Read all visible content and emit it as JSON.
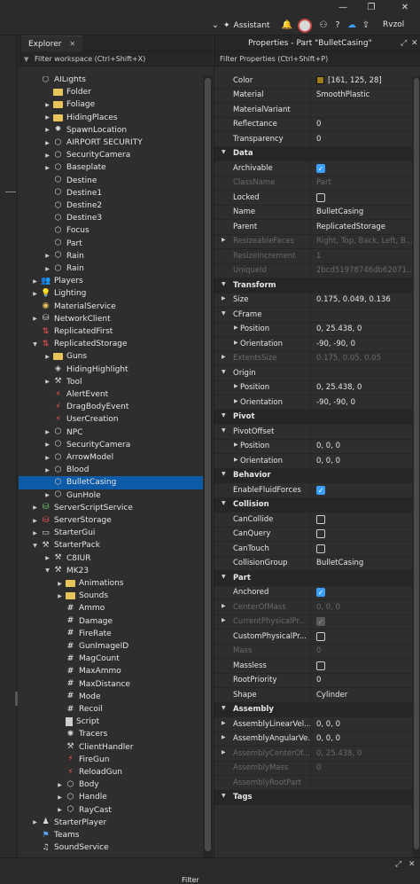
{
  "window": {
    "minimize": "—",
    "maximize": "❐",
    "close": "✕"
  },
  "topbar": {
    "assistant_label": "Assistant",
    "username": "Rvzol"
  },
  "explorer": {
    "tab_label": "Explorer",
    "filter_placeholder": "Filter workspace (Ctrl+Shift+X)",
    "items": [
      {
        "label": "AILights",
        "indent": 0,
        "arrow": "",
        "icon": "part-icon",
        "glyph": "⬡",
        "cls": "part"
      },
      {
        "label": "Folder",
        "indent": 1,
        "arrow": "",
        "icon": "folder-icon",
        "glyph": "",
        "cls": "folder"
      },
      {
        "label": "Foliage",
        "indent": 1,
        "arrow": "▶",
        "icon": "folder-icon",
        "glyph": "",
        "cls": "folder"
      },
      {
        "label": "HidingPlaces",
        "indent": 1,
        "arrow": "▶",
        "icon": "folder-icon",
        "glyph": "",
        "cls": "folder"
      },
      {
        "label": "SpawnLocation",
        "indent": 1,
        "arrow": "▶",
        "icon": "spawn-location-icon",
        "glyph": "✹",
        "cls": ""
      },
      {
        "label": "AIRPORT SECURITY",
        "indent": 1,
        "arrow": "▶",
        "icon": "model-icon",
        "glyph": "⬡",
        "cls": "part"
      },
      {
        "label": "SecurityCamera",
        "indent": 1,
        "arrow": "▶",
        "icon": "model-icon",
        "glyph": "⬡",
        "cls": "part"
      },
      {
        "label": "Baseplate",
        "indent": 1,
        "arrow": "▶",
        "icon": "part-icon",
        "glyph": "⬡",
        "cls": "part"
      },
      {
        "label": "Destine",
        "indent": 1,
        "arrow": "",
        "icon": "part-icon",
        "glyph": "⬡",
        "cls": "part"
      },
      {
        "label": "Destine1",
        "indent": 1,
        "arrow": "",
        "icon": "part-icon",
        "glyph": "⬡",
        "cls": "part"
      },
      {
        "label": "Destine2",
        "indent": 1,
        "arrow": "",
        "icon": "part-icon",
        "glyph": "⬡",
        "cls": "part"
      },
      {
        "label": "Destine3",
        "indent": 1,
        "arrow": "",
        "icon": "part-icon",
        "glyph": "⬡",
        "cls": "part"
      },
      {
        "label": "Focus",
        "indent": 1,
        "arrow": "",
        "icon": "part-icon",
        "glyph": "⬡",
        "cls": "part"
      },
      {
        "label": "Part",
        "indent": 1,
        "arrow": "",
        "icon": "part-icon",
        "glyph": "⬡",
        "cls": "part"
      },
      {
        "label": "Rain",
        "indent": 1,
        "arrow": "▶",
        "icon": "part-icon",
        "glyph": "⬡",
        "cls": "part"
      },
      {
        "label": "Rain",
        "indent": 1,
        "arrow": "▶",
        "icon": "part-icon",
        "glyph": "⬡",
        "cls": "part"
      },
      {
        "label": "Players",
        "indent": 0,
        "arrow": "▶",
        "icon": "players-icon",
        "glyph": "👥",
        "cls": "blue"
      },
      {
        "label": "Lighting",
        "indent": 0,
        "arrow": "▶",
        "icon": "lighting-icon",
        "glyph": "💡",
        "cls": "yellow"
      },
      {
        "label": "MaterialService",
        "indent": 0,
        "arrow": "",
        "icon": "material-service-icon",
        "glyph": "◉",
        "cls": "yellow"
      },
      {
        "label": "NetworkClient",
        "indent": 0,
        "arrow": "▶",
        "icon": "network-client-icon",
        "glyph": "⛁",
        "cls": ""
      },
      {
        "label": "ReplicatedFirst",
        "indent": 0,
        "arrow": "",
        "icon": "replicated-first-icon",
        "glyph": "⇅",
        "cls": "red"
      },
      {
        "label": "ReplicatedStorage",
        "indent": 0,
        "arrow": "▼",
        "icon": "replicated-storage-icon",
        "glyph": "⇅",
        "cls": "red"
      },
      {
        "label": "Guns",
        "indent": 1,
        "arrow": "▶",
        "icon": "folder-icon",
        "glyph": "",
        "cls": "folder"
      },
      {
        "label": "HidingHighlight",
        "indent": 1,
        "arrow": "",
        "icon": "highlight-icon",
        "glyph": "◈",
        "cls": ""
      },
      {
        "label": "Tool",
        "indent": 1,
        "arrow": "▶",
        "icon": "tool-icon",
        "glyph": "⚒",
        "cls": ""
      },
      {
        "label": "AlertEvent",
        "indent": 1,
        "arrow": "",
        "icon": "remote-event-icon",
        "glyph": "⚡",
        "cls": "red"
      },
      {
        "label": "DragBodyEvent",
        "indent": 1,
        "arrow": "",
        "icon": "remote-event-icon",
        "glyph": "⚡",
        "cls": "red"
      },
      {
        "label": "UserCreation",
        "indent": 1,
        "arrow": "",
        "icon": "remote-event-icon",
        "glyph": "⚡",
        "cls": "red"
      },
      {
        "label": "NPC",
        "indent": 1,
        "arrow": "▶",
        "icon": "model-icon",
        "glyph": "⬡",
        "cls": "part"
      },
      {
        "label": "SecurityCamera",
        "indent": 1,
        "arrow": "▶",
        "icon": "model-icon",
        "glyph": "⬡",
        "cls": "part"
      },
      {
        "label": "ArrowModel",
        "indent": 1,
        "arrow": "▶",
        "icon": "model-icon",
        "glyph": "⬡",
        "cls": "part"
      },
      {
        "label": "Blood",
        "indent": 1,
        "arrow": "▶",
        "icon": "part-icon",
        "glyph": "⬡",
        "cls": "part"
      },
      {
        "label": "BulletCasing",
        "indent": 1,
        "arrow": "",
        "icon": "part-icon",
        "glyph": "⬡",
        "cls": "part",
        "selected": true
      },
      {
        "label": "GunHole",
        "indent": 1,
        "arrow": "▶",
        "icon": "part-icon",
        "glyph": "⬡",
        "cls": "part"
      },
      {
        "label": "ServerScriptService",
        "indent": 0,
        "arrow": "▶",
        "icon": "server-script-service-icon",
        "glyph": "⛁",
        "cls": "green"
      },
      {
        "label": "ServerStorage",
        "indent": 0,
        "arrow": "▶",
        "icon": "server-storage-icon",
        "glyph": "⛁",
        "cls": "red"
      },
      {
        "label": "StarterGui",
        "indent": 0,
        "arrow": "▶",
        "icon": "starter-gui-icon",
        "glyph": "▭",
        "cls": ""
      },
      {
        "label": "StarterPack",
        "indent": 0,
        "arrow": "▼",
        "icon": "starter-pack-icon",
        "glyph": "⚒",
        "cls": ""
      },
      {
        "label": "C8IUR",
        "indent": 1,
        "arrow": "▶",
        "icon": "tool-icon",
        "glyph": "⚒",
        "cls": ""
      },
      {
        "label": "MK23",
        "indent": 1,
        "arrow": "▼",
        "icon": "tool-icon",
        "glyph": "⚒",
        "cls": ""
      },
      {
        "label": "Animations",
        "indent": 2,
        "arrow": "▶",
        "icon": "folder-icon",
        "glyph": "",
        "cls": "folder"
      },
      {
        "label": "Sounds",
        "indent": 2,
        "arrow": "▶",
        "icon": "folder-icon",
        "glyph": "",
        "cls": "folder"
      },
      {
        "label": "Ammo",
        "indent": 2,
        "arrow": "",
        "icon": "number-value-icon",
        "glyph": "#",
        "cls": "hash"
      },
      {
        "label": "Damage",
        "indent": 2,
        "arrow": "",
        "icon": "number-value-icon",
        "glyph": "#",
        "cls": "hash"
      },
      {
        "label": "FireRate",
        "indent": 2,
        "arrow": "",
        "icon": "number-value-icon",
        "glyph": "#",
        "cls": "hash"
      },
      {
        "label": "GunImageID",
        "indent": 2,
        "arrow": "",
        "icon": "number-value-icon",
        "glyph": "#",
        "cls": "hash"
      },
      {
        "label": "MagCount",
        "indent": 2,
        "arrow": "",
        "icon": "number-value-icon",
        "glyph": "#",
        "cls": "hash"
      },
      {
        "label": "MaxAmmo",
        "indent": 2,
        "arrow": "",
        "icon": "number-value-icon",
        "glyph": "#",
        "cls": "hash"
      },
      {
        "label": "MaxDistance",
        "indent": 2,
        "arrow": "",
        "icon": "number-value-icon",
        "glyph": "#",
        "cls": "hash"
      },
      {
        "label": "Mode",
        "indent": 2,
        "arrow": "",
        "icon": "number-value-icon",
        "glyph": "#",
        "cls": "hash"
      },
      {
        "label": "Recoil",
        "indent": 2,
        "arrow": "",
        "icon": "number-value-icon",
        "glyph": "#",
        "cls": "hash"
      },
      {
        "label": "Script",
        "indent": 2,
        "arrow": "",
        "icon": "script-icon",
        "glyph": "",
        "cls": "script"
      },
      {
        "label": "Tracers",
        "indent": 2,
        "arrow": "",
        "icon": "particle-icon",
        "glyph": "✺",
        "cls": ""
      },
      {
        "label": "ClientHandler",
        "indent": 2,
        "arrow": "",
        "icon": "local-script-icon",
        "glyph": "⚒",
        "cls": ""
      },
      {
        "label": "FireGun",
        "indent": 2,
        "arrow": "",
        "icon": "remote-event-icon",
        "glyph": "⚡",
        "cls": "red"
      },
      {
        "label": "ReloadGun",
        "indent": 2,
        "arrow": "",
        "icon": "remote-event-icon",
        "glyph": "⚡",
        "cls": "red"
      },
      {
        "label": "Body",
        "indent": 2,
        "arrow": "▶",
        "icon": "part-icon",
        "glyph": "⬡",
        "cls": "part"
      },
      {
        "label": "Handle",
        "indent": 2,
        "arrow": "▶",
        "icon": "part-icon",
        "glyph": "⬡",
        "cls": "part"
      },
      {
        "label": "RayCast",
        "indent": 2,
        "arrow": "▶",
        "icon": "part-icon",
        "glyph": "⬡",
        "cls": "part"
      },
      {
        "label": "StarterPlayer",
        "indent": 0,
        "arrow": "▶",
        "icon": "starter-player-icon",
        "glyph": "♟",
        "cls": ""
      },
      {
        "label": "Teams",
        "indent": 0,
        "arrow": "",
        "icon": "teams-icon",
        "glyph": "⚑",
        "cls": "blue"
      },
      {
        "label": "SoundService",
        "indent": 0,
        "arrow": "",
        "icon": "sound-service-icon",
        "glyph": "♫",
        "cls": ""
      }
    ]
  },
  "properties": {
    "title": "Properties - Part \"BulletCasing\"",
    "filter_placeholder": "Filter Properties (Ctrl+Shift+P)",
    "rows": [
      {
        "type": "prop",
        "name": "Color",
        "value": "[161, 125, 28]",
        "swatch": "#a17d1c"
      },
      {
        "type": "prop",
        "name": "Material",
        "value": "SmoothPlastic"
      },
      {
        "type": "prop",
        "name": "MaterialVariant",
        "value": ""
      },
      {
        "type": "prop",
        "name": "Reflectance",
        "value": "0"
      },
      {
        "type": "prop",
        "name": "Transparency",
        "value": "0"
      },
      {
        "type": "section",
        "name": "Data"
      },
      {
        "type": "prop",
        "name": "Archivable",
        "check": "on"
      },
      {
        "type": "prop",
        "name": "ClassName",
        "value": "Part",
        "dim": true
      },
      {
        "type": "prop",
        "name": "Locked",
        "check": "off"
      },
      {
        "type": "prop",
        "name": "Name",
        "value": "BulletCasing"
      },
      {
        "type": "prop",
        "name": "Parent",
        "value": "ReplicatedStorage"
      },
      {
        "type": "prop",
        "name": "ResizeableFaces",
        "value": "Right, Top, Back, Left, B...",
        "dim": true,
        "expander": "▶"
      },
      {
        "type": "prop",
        "name": "ResizeIncrement",
        "value": "1",
        "dim": true
      },
      {
        "type": "prop",
        "name": "UniqueId",
        "value": "2bcd51978746db62071...",
        "dim": true
      },
      {
        "type": "section",
        "name": "Transform"
      },
      {
        "type": "prop",
        "name": "Size",
        "value": "0.175, 0.049, 0.136",
        "expander": "▶"
      },
      {
        "type": "prop",
        "name": "CFrame",
        "value": "",
        "expander": "▼"
      },
      {
        "type": "prop",
        "name": "Position",
        "value": "0, 25.438, 0",
        "expander": "▶",
        "indent": true
      },
      {
        "type": "prop",
        "name": "Orientation",
        "value": "-90, -90, 0",
        "expander": "▶",
        "indent": true
      },
      {
        "type": "prop",
        "name": "ExtentsSize",
        "value": "0.175, 0.05, 0.05",
        "dim": true,
        "expander": "▶"
      },
      {
        "type": "prop",
        "name": "Origin",
        "value": "",
        "expander": "▼"
      },
      {
        "type": "prop",
        "name": "Position",
        "value": "0, 25.438, 0",
        "expander": "▶",
        "indent": true
      },
      {
        "type": "prop",
        "name": "Orientation",
        "value": "-90, -90, 0",
        "expander": "▶",
        "indent": true
      },
      {
        "type": "section",
        "name": "Pivot"
      },
      {
        "type": "prop",
        "name": "PivotOffset",
        "value": "",
        "expander": "▼"
      },
      {
        "type": "prop",
        "name": "Position",
        "value": "0, 0, 0",
        "expander": "▶",
        "indent": true
      },
      {
        "type": "prop",
        "name": "Orientation",
        "value": "0, 0, 0",
        "expander": "▶",
        "indent": true
      },
      {
        "type": "section",
        "name": "Behavior"
      },
      {
        "type": "prop",
        "name": "EnableFluidForces",
        "check": "on"
      },
      {
        "type": "section",
        "name": "Collision"
      },
      {
        "type": "prop",
        "name": "CanCollide",
        "check": "off"
      },
      {
        "type": "prop",
        "name": "CanQuery",
        "check": "off"
      },
      {
        "type": "prop",
        "name": "CanTouch",
        "check": "off"
      },
      {
        "type": "prop",
        "name": "CollisionGroup",
        "value": "BulletCasing"
      },
      {
        "type": "section",
        "name": "Part"
      },
      {
        "type": "prop",
        "name": "Anchored",
        "check": "on"
      },
      {
        "type": "prop",
        "name": "CenterOfMass",
        "value": "0, 0, 0",
        "dim": true,
        "expander": "▶"
      },
      {
        "type": "prop",
        "name": "CurrentPhysicalPr...",
        "check": "dimon",
        "dim": true,
        "expander": "▶"
      },
      {
        "type": "prop",
        "name": "CustomPhysicalPr...",
        "check": "off"
      },
      {
        "type": "prop",
        "name": "Mass",
        "value": "0",
        "dim": true
      },
      {
        "type": "prop",
        "name": "Massless",
        "check": "off"
      },
      {
        "type": "prop",
        "name": "RootPriority",
        "value": "0"
      },
      {
        "type": "prop",
        "name": "Shape",
        "value": "Cylinder"
      },
      {
        "type": "section",
        "name": "Assembly"
      },
      {
        "type": "prop",
        "name": "AssemblyLinearVel...",
        "value": "0, 0, 0",
        "expander": "▶"
      },
      {
        "type": "prop",
        "name": "AssemblyAngularVe...",
        "value": "0, 0, 0",
        "expander": "▶"
      },
      {
        "type": "prop",
        "name": "AssemblyCenterOf...",
        "value": "0, 25.438, 0",
        "dim": true,
        "expander": "▶"
      },
      {
        "type": "prop",
        "name": "AssemblyMass",
        "value": "0",
        "dim": true
      },
      {
        "type": "prop",
        "name": "AssemblyRootPart",
        "value": "",
        "dim": true
      },
      {
        "type": "section",
        "name": "Tags"
      }
    ]
  },
  "bottom": {
    "filter_label": "Filter"
  }
}
